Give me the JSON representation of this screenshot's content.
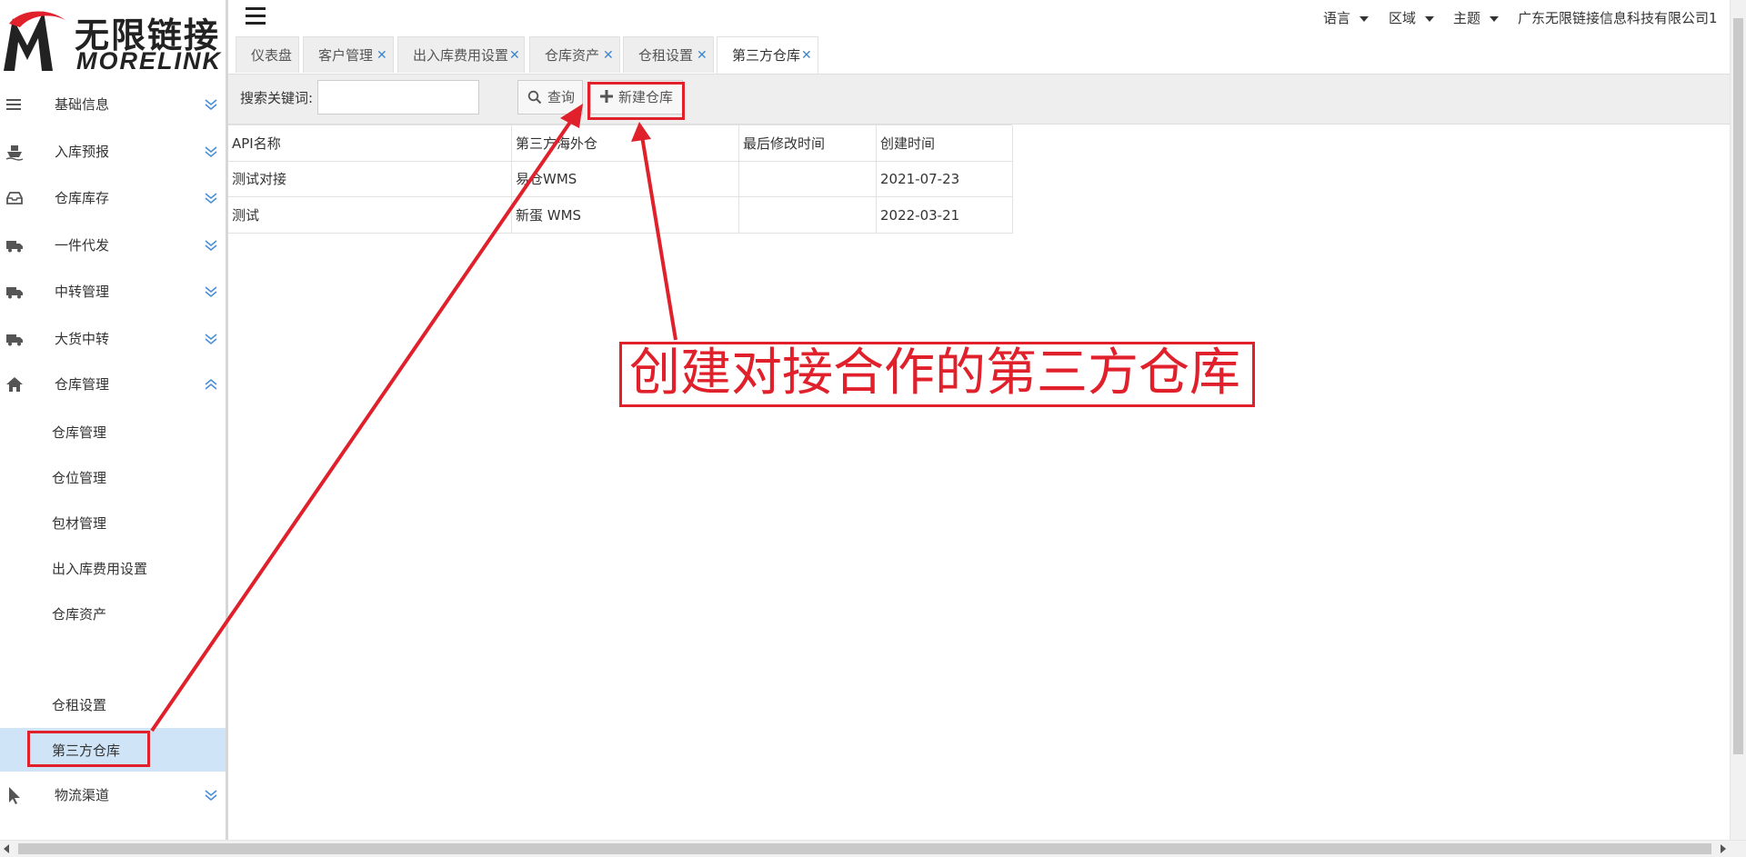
{
  "app": {
    "logo_cn": "无限链接",
    "logo_en": "MORELINK"
  },
  "header": {
    "language": "语言",
    "region": "区域",
    "theme": "主题",
    "company": "广东无限链接信息科技有限公司1"
  },
  "sidebar": {
    "items": [
      {
        "label": "基础信息",
        "icon": "list-icon"
      },
      {
        "label": "入库预报",
        "icon": "ship-icon"
      },
      {
        "label": "仓库库存",
        "icon": "inbox-icon"
      },
      {
        "label": "一件代发",
        "icon": "truck-icon"
      },
      {
        "label": "中转管理",
        "icon": "truck-icon"
      },
      {
        "label": "大货中转",
        "icon": "truck-icon"
      },
      {
        "label": "仓库管理",
        "icon": "home-icon"
      }
    ],
    "sub_items": [
      "仓库管理",
      "仓位管理",
      "包材管理",
      "出入库费用设置",
      "仓库资产",
      "仓租设置",
      "第三方仓库"
    ],
    "active_sub": "第三方仓库",
    "bottom_items": [
      {
        "label": "物流渠道",
        "icon": "cursor-icon"
      }
    ]
  },
  "tabs": [
    {
      "label": "仪表盘",
      "closable": false
    },
    {
      "label": "客户管理",
      "closable": true
    },
    {
      "label": "出入库费用设置",
      "closable": true
    },
    {
      "label": "仓库资产",
      "closable": true
    },
    {
      "label": "仓租设置",
      "closable": true
    },
    {
      "label": "第三方仓库",
      "closable": true,
      "active": true
    }
  ],
  "toolbar": {
    "search_label": "搜索关键词:",
    "search_value": "",
    "query_button": "查询",
    "new_button": "新建仓库"
  },
  "table": {
    "columns": [
      "API名称",
      "第三方海外仓",
      "最后修改时间",
      "创建时间"
    ],
    "rows": [
      [
        "测试对接",
        "易仓WMS",
        "",
        "2021-07-23"
      ],
      [
        "测试",
        "新蛋 WMS",
        "",
        "2022-03-21"
      ]
    ]
  },
  "annotation": {
    "text": "创建对接合作的第三方仓库",
    "color": "#e0202a"
  },
  "colors": {
    "active_sub_bg": "#cfe4f7",
    "tab_close": "#3f86c9",
    "annotation": "#e0202a"
  }
}
